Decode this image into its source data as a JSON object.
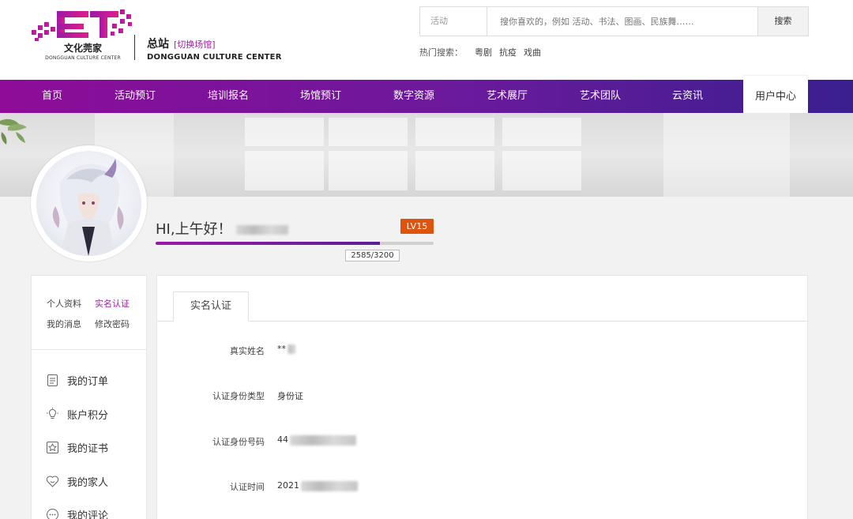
{
  "logo": {
    "cn": "文化莞家",
    "en": "DONGGUAN CULTURE CENTER"
  },
  "site": {
    "name": "总站",
    "switch": "[切换场馆]",
    "en": "DONGGUAN CULTURE CENTER"
  },
  "search": {
    "category": "活动",
    "placeholder": "搜你喜欢的，例如 活动、书法、图画、民族舞……",
    "button": "搜索"
  },
  "hot": {
    "label": "热门搜索：",
    "items": [
      "粤剧",
      "抗疫",
      "戏曲"
    ]
  },
  "nav": {
    "items": [
      "首页",
      "活动预订",
      "培训报名",
      "场馆预订",
      "数字资源",
      "艺术展厅",
      "艺术团队",
      "云资讯"
    ],
    "active": "用户中心"
  },
  "profile": {
    "greeting": "HI,上午好！",
    "level": "LV15",
    "exp_text": "2585/3200",
    "exp_current": 2585,
    "exp_total": 3200
  },
  "sidebar": {
    "links": [
      "个人资料",
      "实名认证",
      "我的消息",
      "修改密码"
    ],
    "active_link": "实名认证",
    "items": [
      {
        "label": "我的订单",
        "icon": "document-icon"
      },
      {
        "label": "账户积分",
        "icon": "lightbulb-icon"
      },
      {
        "label": "我的证书",
        "icon": "certificate-icon"
      },
      {
        "label": "我的家人",
        "icon": "heart-icon"
      },
      {
        "label": "我的评论",
        "icon": "comment-icon"
      }
    ]
  },
  "main": {
    "tab": "实名认证",
    "fields": [
      {
        "label": "真实姓名",
        "value": "**"
      },
      {
        "label": "认证身份类型",
        "value": "身份证"
      },
      {
        "label": "认证身份号码",
        "value": "44"
      },
      {
        "label": "认证时间",
        "value": "2021"
      }
    ]
  },
  "colors": {
    "brand": "#8e0c98",
    "accent": "#a020a0",
    "level": "#e0530c"
  }
}
